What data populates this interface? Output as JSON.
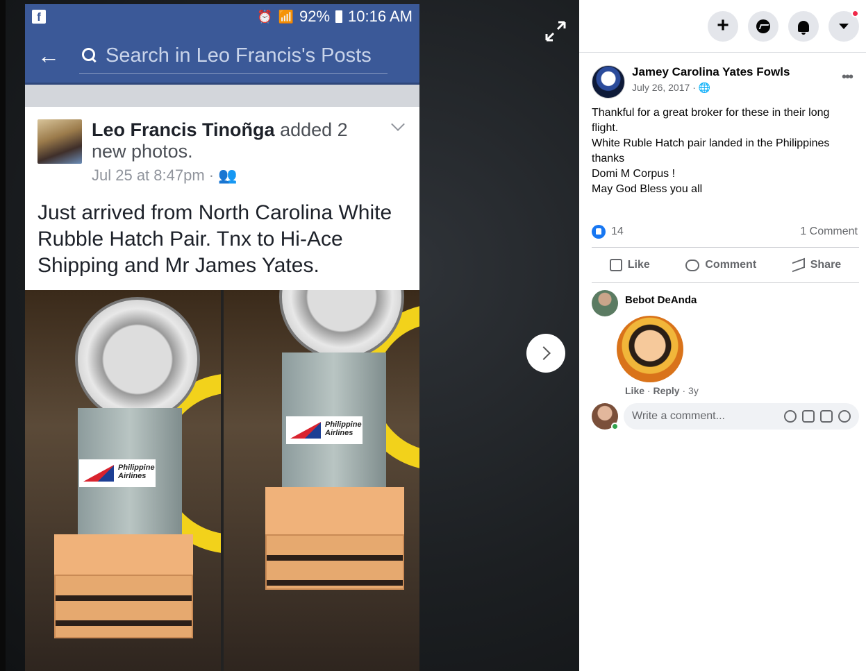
{
  "phone": {
    "status": {
      "battery": "92%",
      "time": "10:16 AM"
    },
    "search_placeholder": "Search in Leo Francis's Posts",
    "post": {
      "author": "Leo Francis Tinoñga",
      "action": "added 2 new photos.",
      "timestamp": "Jul 25 at 8:47pm",
      "body": "Just arrived from North Carolina White Rubble Hatch Pair. Tnx to Hi-Ace Shipping and Mr James Yates.",
      "photo_sticker_text": "Philippine Airlines"
    }
  },
  "sidebar": {
    "post": {
      "page_name": "Jamey Carolina Yates Fowls",
      "date": "July 26, 2017",
      "text": "Thankful for a great broker for these in their long flight.\nWhite Ruble Hatch pair landed in the Philippines thanks\nDomi M Corpus !\nMay God Bless you all",
      "reaction_count": "14",
      "comment_count": "1 Comment",
      "actions": {
        "like": "Like",
        "comment": "Comment",
        "share": "Share"
      }
    },
    "comment": {
      "author": "Bebot DeAnda",
      "like": "Like",
      "reply": "Reply",
      "age": "3y"
    },
    "write_placeholder": "Write a comment..."
  },
  "colors": {
    "facebook_blue": "#3b5998",
    "like_blue": "#1877f2",
    "notification_red": "#f02849"
  }
}
